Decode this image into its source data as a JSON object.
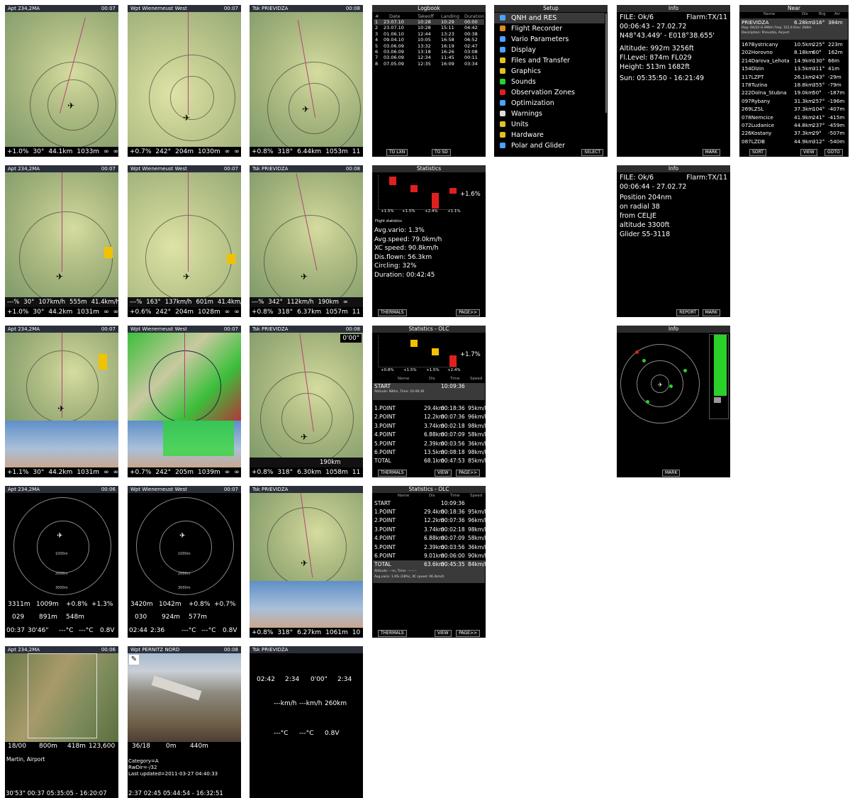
{
  "colors": {
    "panel_bg": "#000000",
    "map_track": "#b5417a",
    "accent_red": "#e0201e",
    "accent_yellow": "#f2c200",
    "accent_green": "#2ad12a"
  },
  "titles": {
    "apt": "Apt 234,2MA",
    "wpt": "Wpt Wienerneust West",
    "tsk": "Tsk PRIEVIDZA",
    "wpt_pernitz": "Wpt PERNITZ NORD",
    "time_07": "00:07",
    "time_08": "00:08",
    "time_06": "00:06"
  },
  "row1": {
    "map1_status": [
      "+1.0%",
      "30°",
      "44.1km",
      "1033m",
      "∞",
      "∞"
    ],
    "map2_status": [
      "+0.7%",
      "242°",
      "204m",
      "1030m",
      "∞",
      "∞"
    ],
    "map3_status": [
      "+0.8%",
      "318°",
      "6.44km",
      "1053m",
      "11",
      "∞"
    ],
    "logbook": {
      "title": "Logbook",
      "headers": [
        "#",
        "Date",
        "Takeoff",
        "Landing",
        "Duration"
      ],
      "rows": [
        [
          "1",
          "23.07.10",
          "10:28",
          "10:29",
          "00:00"
        ],
        [
          "2",
          "23.07.10",
          "10:28",
          "15:11",
          "04:42"
        ],
        [
          "3",
          "01.06.10",
          "12:44",
          "13:23",
          "00:38"
        ],
        [
          "4",
          "09.04.10",
          "10:05",
          "16:58",
          "06:52"
        ],
        [
          "5",
          "03.06.09",
          "13:32",
          "16:19",
          "02:47"
        ],
        [
          "6",
          "03.06.09",
          "13:18",
          "16:26",
          "03:08"
        ],
        [
          "7",
          "03.06.09",
          "12:34",
          "11:45",
          "00:11"
        ],
        [
          "8",
          "07.05.09",
          "12:35",
          "16:09",
          "03:34"
        ]
      ],
      "btn_left": "TO LXN",
      "btn_right": "TO SD"
    },
    "setup": {
      "title": "Setup",
      "items": [
        "QNH and RES",
        "Flight Recorder",
        "Vario Parameters",
        "Display",
        "Files and Transfer",
        "Graphics",
        "Sounds",
        "Observation Zones",
        "Optimization",
        "Warnings",
        "Units",
        "Hardware",
        "Polar and Glider"
      ],
      "button": "SELECT"
    },
    "info": {
      "title": "Info",
      "lines": [
        "FILE: Ok/6",
        "00:06:43 - 27.02.72",
        "N48°43.449' - E018°38.655'",
        "Altitude:  992m   3256ft",
        "Fl.Level:  874m   FL029",
        "Height:    513m   1682ft",
        "Sun: 05:35:50 - 16:21:49"
      ],
      "flarm": "Flarm:TX/11",
      "button": "MARK"
    },
    "near": {
      "title": "Near",
      "headers": [
        "Name",
        "Dis",
        "Brg",
        "Arr"
      ],
      "selected": {
        "name": "PRIEVIDZA",
        "dis": "6.28km",
        "brg": "316°",
        "arr": "384m"
      },
      "subline1": "Rwy: 04/22-G-990m   Freq: 122,6   Elev: 268m",
      "subline2": "Description: Prievidza, Airport",
      "rows": [
        [
          "167Bystricany",
          "10.5km",
          "225°",
          "223m"
        ],
        [
          "202Horovno",
          "8.18km",
          "60°",
          "162m"
        ],
        [
          "214Darova_Lehota",
          "14.9km",
          "130°",
          "66m"
        ],
        [
          "154Dlzin",
          "13.5km",
          "311°",
          "41m"
        ],
        [
          "117LZPT",
          "26.1km",
          "243°",
          "-29m"
        ],
        [
          "178Tuzina",
          "18.8km",
          "355°",
          "-79m"
        ],
        [
          "222Dolna_Stubna",
          "19.0km",
          "50°",
          "-187m"
        ],
        [
          "097Rybany",
          "31.3km",
          "257°",
          "-196m"
        ],
        [
          "269LZSL",
          "37.3km",
          "104°",
          "-407m"
        ],
        [
          "078Nemcice",
          "41.9km",
          "241°",
          "-415m"
        ],
        [
          "072Ludanice",
          "44.8km",
          "237°",
          "-459m"
        ],
        [
          "226Kostany",
          "37.3km",
          "29°",
          "-507m"
        ],
        [
          "087LZDB",
          "44.9km",
          "312°",
          "-540m"
        ]
      ],
      "btn_sort": "SORT",
      "btn_view": "VIEW",
      "btn_goto": "GOTO"
    }
  },
  "row2": {
    "map1_top": [
      "---%",
      "30°",
      "107km/h",
      "555m",
      "41.4km/h"
    ],
    "map1_status": [
      "+1.0%",
      "30°",
      "44.2km",
      "1031m",
      "∞",
      "∞"
    ],
    "map2_top": [
      "---%",
      "163°",
      "137km/h",
      "601m",
      "41.4km/h"
    ],
    "map2_status": [
      "+0.6%",
      "242°",
      "204m",
      "1028m",
      "∞",
      "∞"
    ],
    "map3_top": [
      "---%",
      "342°",
      "112km/h",
      "190km",
      "∞"
    ],
    "map3_status": [
      "+0.8%",
      "318°",
      "6.37km",
      "1057m",
      "11",
      "∞"
    ],
    "statistics": {
      "title": "Statistics",
      "bar_labels": [
        "+1.5%",
        "+1.5%",
        "+2.4%",
        "+1.1%"
      ],
      "current": "+1.6%",
      "flight_stats_label": "Flight statistics",
      "lines": [
        "Avg.vario: 1.3%",
        "Avg.speed: 79.0km/h",
        "XC speed: 90.8km/h",
        "Dis.flown: 56.3km",
        "Circling: 32%",
        "Duration: 00:42:45"
      ],
      "btn_left": "THERMALS",
      "btn_right": "PAGE>>"
    },
    "info2": {
      "title": "Info",
      "flarm": "Flarm:TX/11",
      "lines": [
        "FILE: Ok/6",
        "00:06:44 - 27.02.72",
        "Position 204nm",
        "on radial 38",
        "from CELJE",
        "altitude 3300ft",
        "Glider S5-3118"
      ],
      "btn_report": "REPORT",
      "btn_mark": "MARK"
    }
  },
  "row3": {
    "map1_status": [
      "+1.1%",
      "30°",
      "44.2km",
      "1031m",
      "∞",
      "∞"
    ],
    "map2_status": [
      "+0.7%",
      "242°",
      "205m",
      "1039m",
      "∞",
      "∞"
    ],
    "map3_status": [
      "+0.8%",
      "318°",
      "6.30km",
      "1058m",
      "11",
      "∞"
    ],
    "map3_badge": "0'00\"",
    "map3_mid": "190km",
    "olc": {
      "title": "Statistics - OLC",
      "bar_labels": [
        "+0.8%",
        "+1.5%",
        "+1.5%",
        "+2.4%"
      ],
      "current": "+1.7%",
      "headers": [
        "Name",
        "Dis",
        "Time",
        "Speed"
      ],
      "start": "START",
      "start_time": "10:09:36",
      "start_sub": "Altitude: 980m, Time: 10:09:36",
      "rows": [
        [
          "1.POINT",
          "29.4km",
          "00:18:36",
          "95km/h"
        ],
        [
          "2.POINT",
          "12.2km",
          "00:07:36",
          "96km/h"
        ],
        [
          "3.POINT",
          "3.74km",
          "00:02:18",
          "98km/h"
        ],
        [
          "4.POINT",
          "6.88km",
          "00:07:09",
          "58km/h"
        ],
        [
          "5.POINT",
          "2.39km",
          "00:03:56",
          "36km/h"
        ],
        [
          "6.POINT",
          "13.5km",
          "00:08:18",
          "98km/h"
        ],
        [
          "TOTAL",
          "68.1km",
          "00:47:53",
          "85km/h"
        ]
      ],
      "btn_left": "THERMALS",
      "btn_mid": "VIEW",
      "btn_right": "PAGE>>"
    },
    "flarm_info": {
      "title": "Info",
      "button": "MARK"
    }
  },
  "row4": {
    "nav1": {
      "vals_a": [
        "3311m",
        "1009m",
        "+0.8%",
        "+1.3%"
      ],
      "vals_b": [
        "029",
        "891m",
        "548m"
      ],
      "vals_c": [
        "00:37",
        "30'46\"",
        "---°C",
        "---°C",
        "0.8V"
      ],
      "ring_labels": [
        "1000m",
        "2000m",
        "3000m"
      ]
    },
    "nav2": {
      "vals_a": [
        "3420m",
        "1042m",
        "+0.8%",
        "+0.7%"
      ],
      "vals_b": [
        "030",
        "924m",
        "577m"
      ],
      "vals_c": [
        "02:44",
        "2:36",
        "---°C",
        "---°C",
        "0.8V"
      ],
      "ring_labels": [
        "1000m",
        "2000m",
        "3000m"
      ]
    },
    "map3_status": [
      "+0.8%",
      "318°",
      "6.27km",
      "1061m",
      "10",
      "∞"
    ],
    "olc2": {
      "title": "Statistics - OLC",
      "headers": [
        "Name",
        "Dis",
        "Time",
        "Speed"
      ],
      "start": "START",
      "start_time": "10:09:36",
      "rows": [
        [
          "1.POINT",
          "29.4km",
          "00:18:36",
          "95km/h"
        ],
        [
          "2.POINT",
          "12.2km",
          "00:07:36",
          "96km/h"
        ],
        [
          "3.POINT",
          "3.74km",
          "00:02:18",
          "98km/h"
        ],
        [
          "4.POINT",
          "6.88km",
          "00:07:09",
          "58km/h"
        ],
        [
          "5.POINT",
          "2.39km",
          "00:03:56",
          "36km/h"
        ],
        [
          "6.POINT",
          "9.01km",
          "00:06:00",
          "90km/h"
        ]
      ],
      "total": [
        "TOTAL",
        "63.6km",
        "00:45:35",
        "84km/h"
      ],
      "total_sub1": "Altitude: ---m, Time: --:--:--",
      "total_sub2": "Avg.vario: 1.6% (28%), XC speed: 96.4km/h",
      "btn_left": "THERMALS",
      "btn_mid": "VIEW",
      "btn_right": "PAGE>>"
    }
  },
  "row5": {
    "apt": {
      "vals": [
        "18/00",
        "800m",
        "418m",
        "123,600"
      ],
      "desc": "Martin, Airport",
      "bottom": "30'53\"  00:37  05:35:05 - 16:20:07"
    },
    "wpt": {
      "vals": [
        "36/18",
        "0m",
        "440m"
      ],
      "lines": [
        "Category=A",
        "RwDir=-/32",
        "Last updated=2011-03-27 04:40:33"
      ],
      "bottom": "2:37  02:45  05:44:54 - 16:32:51"
    },
    "tsk": {
      "vals_a": [
        "02:42",
        "2:34",
        "0'00\"",
        "2:34"
      ],
      "vals_b": [
        "---km/h",
        "---km/h",
        "260km"
      ],
      "vals_c": [
        "---°C",
        "---°C",
        "0.8V"
      ]
    }
  }
}
